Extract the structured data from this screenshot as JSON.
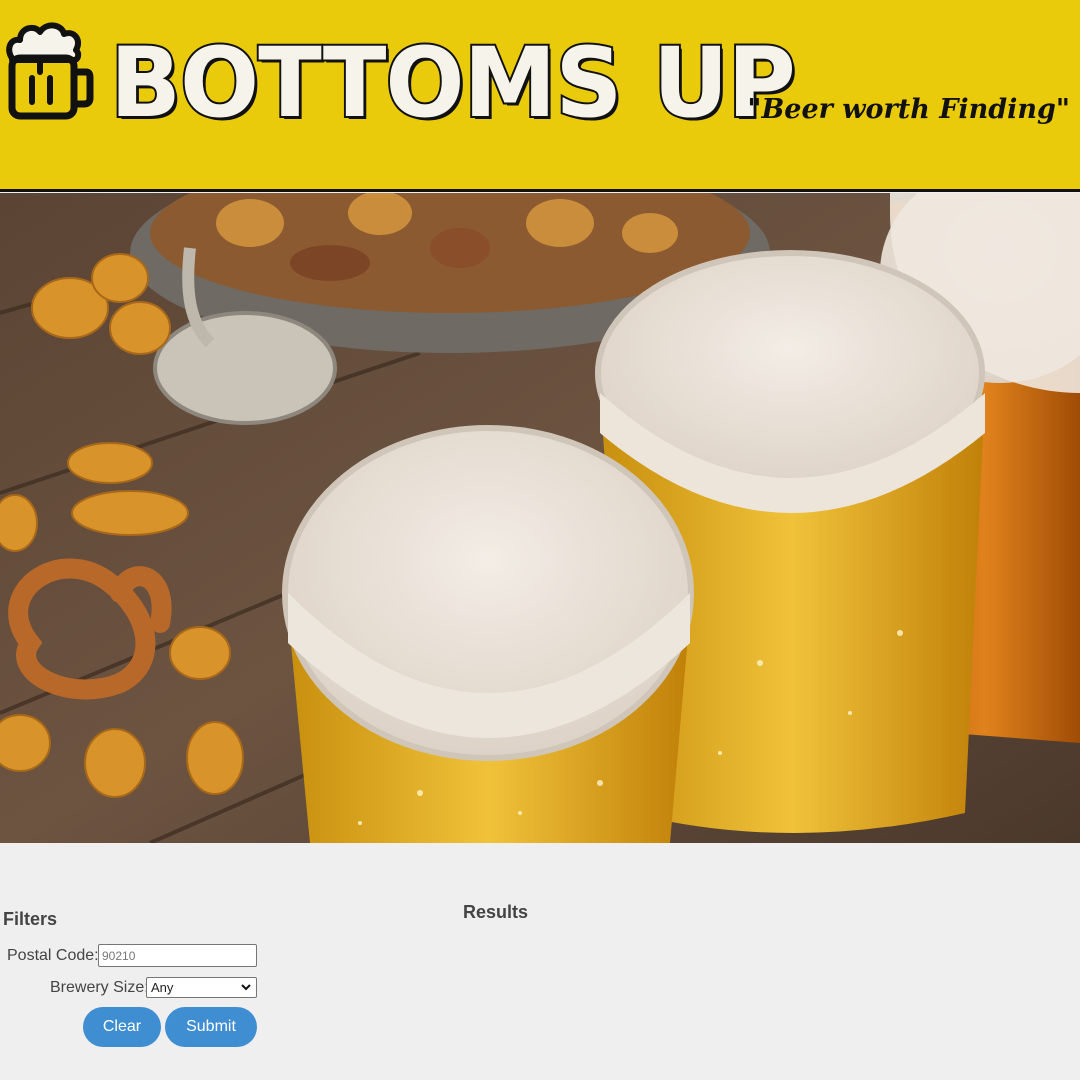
{
  "header": {
    "title": "BOTTOMS UP",
    "tagline": "\"Beer worth Finding\"",
    "logo_icon": "beer-mug-icon",
    "background_color": "#eacb0c"
  },
  "hero": {
    "icon": "beers-and-snacks-photo"
  },
  "filters": {
    "title": "Filters",
    "postal_label": "Postal Code:",
    "postal_placeholder": "90210",
    "size_label": "Brewery Size:",
    "size_selected": "Any",
    "clear_label": "Clear",
    "submit_label": "Submit",
    "button_color": "#3f8ed1"
  },
  "results": {
    "title": "Results"
  }
}
